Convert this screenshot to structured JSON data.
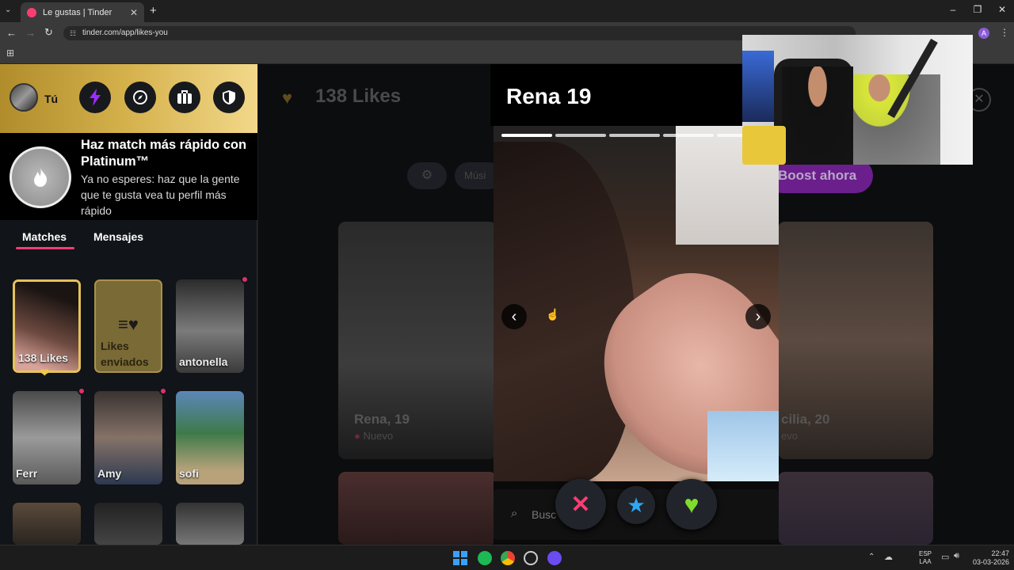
{
  "browser": {
    "tab_title": "Le gustas | Tinder",
    "url": "tinder.com/app/likes-you",
    "new_tab": "+",
    "close_tab": "✕",
    "account_initial": "A"
  },
  "sidebar": {
    "user_label": "Tú",
    "promo": {
      "title": "Haz match más rápido con Platinum™",
      "subtitle": "Ya no esperes: haz que la gente que te gusta vea tu perfil más rápido"
    },
    "tabs": [
      {
        "label": "Matches",
        "active": true
      },
      {
        "label": "Mensajes",
        "active": false
      }
    ],
    "likes_card": {
      "label": "138 Likes"
    },
    "sent_card": {
      "label": "Likes enviados"
    },
    "matches": [
      {
        "name": "antonella",
        "new": true
      },
      {
        "name": "Ferr",
        "new": true
      },
      {
        "name": "Amy",
        "new": true
      },
      {
        "name": "sofi",
        "new": false
      }
    ]
  },
  "main": {
    "likes_title": "138 Likes",
    "filter_chip": "Músi",
    "boost_button": "Boost ahora",
    "grid_cards": [
      {
        "name": "Rena, 19",
        "status": "Nuevo"
      },
      {
        "name": "cilia, 20",
        "status": "evo"
      }
    ]
  },
  "modal": {
    "name": "Rena 19",
    "photo_count": 5,
    "active_photo": 1,
    "search_placeholder": "Busc"
  },
  "taskbar": {
    "lang_top": "ESP",
    "lang_bottom": "LAA",
    "time": "22:47",
    "date": "03-03-2026"
  },
  "colors": {
    "accent": "#fe3c72",
    "gold": "#d6b24d",
    "boost": "#a020c0"
  }
}
